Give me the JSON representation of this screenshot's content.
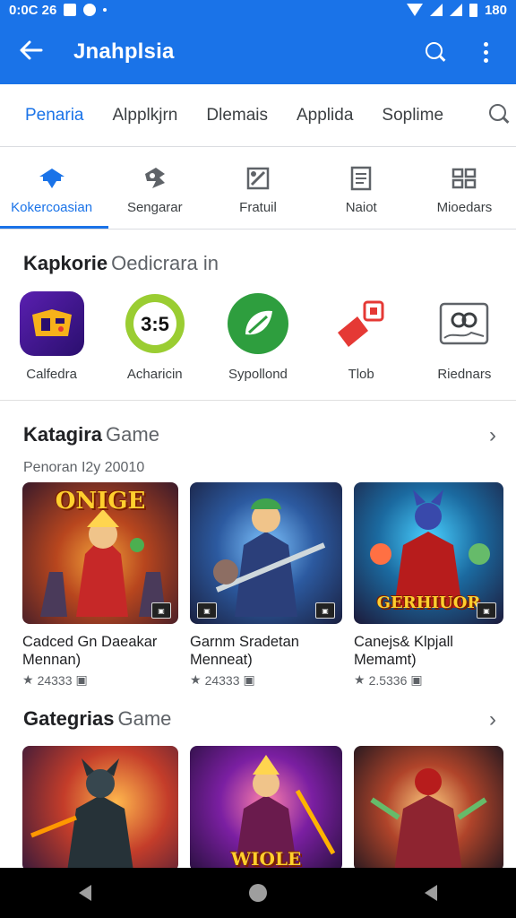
{
  "status_bar": {
    "time": "0:0C 26",
    "battery_text": "180"
  },
  "app_bar": {
    "title": "Jnahplsia"
  },
  "top_tabs": [
    {
      "label": "Penaria",
      "active": true
    },
    {
      "label": "Alpplkjrn",
      "active": false
    },
    {
      "label": "Dlemais",
      "active": false
    },
    {
      "label": "Applida",
      "active": false
    },
    {
      "label": "Soplime",
      "active": false
    }
  ],
  "category_tabs": [
    {
      "label": "Kokercoasian",
      "icon": "home-icon",
      "active": true
    },
    {
      "label": "Sengarar",
      "icon": "puzzle-icon",
      "active": false
    },
    {
      "label": "Fratuil",
      "icon": "tools-icon",
      "active": false
    },
    {
      "label": "Naiot",
      "icon": "document-icon",
      "active": false
    },
    {
      "label": "Mioedars",
      "icon": "grid-icon",
      "active": false
    }
  ],
  "recommended": {
    "title": "Kapkorie",
    "subtitle": "Oedicrara in",
    "apps": [
      {
        "label": "Calfedra",
        "icon": "game-controller-icon"
      },
      {
        "label": "Acharicin",
        "icon": "chat-bubble-icon"
      },
      {
        "label": "Sypollond",
        "icon": "leaf-icon"
      },
      {
        "label": "Tlob",
        "icon": "pin-icon"
      },
      {
        "label": "Riednars",
        "icon": "map-icon"
      }
    ]
  },
  "section1": {
    "title": "Katagira",
    "subtitle": "Game",
    "caption": "Penoran I2y 20010",
    "games": [
      {
        "name": "Cadced Gn Daeakar Mennan)",
        "rating": "24333",
        "art_text": "ONIGE"
      },
      {
        "name": "Garnm Sradetan Menneat)",
        "rating": "24333",
        "art_text": ""
      },
      {
        "name": "Canejs& Klpjall Memamt)",
        "rating": "2.5336",
        "art_text": "GERHIUOR"
      }
    ]
  },
  "section2": {
    "title": "Gategrias",
    "subtitle": "Game",
    "games": [
      {
        "art_text": ""
      },
      {
        "art_text": "WIOLE"
      },
      {
        "art_text": ""
      }
    ]
  },
  "colors": {
    "primary": "#1a73e8",
    "text": "#202124",
    "muted": "#5f6368"
  }
}
